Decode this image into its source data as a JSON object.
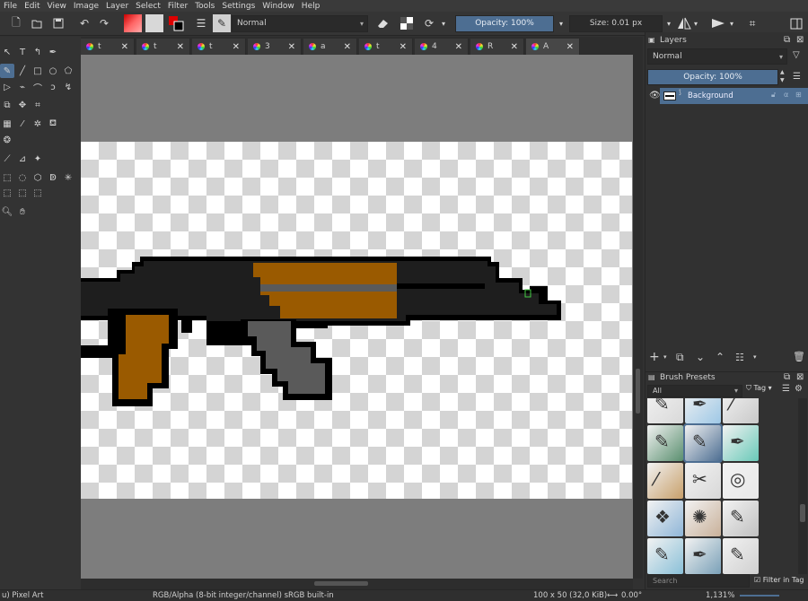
{
  "menu": [
    "File",
    "Edit",
    "View",
    "Image",
    "Layer",
    "Select",
    "Filter",
    "Tools",
    "Settings",
    "Window",
    "Help"
  ],
  "toolbar": {
    "blend_mode": "Normal",
    "opacity_label": "Opacity: 100%",
    "size_label": "Size: 0.01 px"
  },
  "tabs": [
    {
      "label": "t"
    },
    {
      "label": "t"
    },
    {
      "label": "t"
    },
    {
      "label": "3"
    },
    {
      "label": "a"
    },
    {
      "label": "t"
    },
    {
      "label": "4"
    },
    {
      "label": "R"
    },
    {
      "label": "A"
    }
  ],
  "layers": {
    "title": "Layers",
    "blend_mode": "Normal",
    "opacity_label": "Opacity:  100%",
    "items": [
      {
        "name": "Background"
      }
    ]
  },
  "brush_presets": {
    "title": "Brush Presets",
    "filter": "All",
    "tag_label": "Tag",
    "search_placeholder": "Search",
    "filter_in_tag": "Filter in Tag"
  },
  "status": {
    "left": "u) Pixel Art",
    "colorspace": "RGB/Alpha (8-bit integer/channel)  sRGB built-in",
    "size": "100 x 50 (32,0 KiB)",
    "rotation": "0.00°",
    "zoom": "1,131%"
  },
  "colors": {
    "accent": "#4d6e92",
    "gun_black": "#000000",
    "gun_body": "#1e1e1e",
    "gun_wood": "#9a5a00",
    "gun_grey": "#5a5a5a"
  }
}
